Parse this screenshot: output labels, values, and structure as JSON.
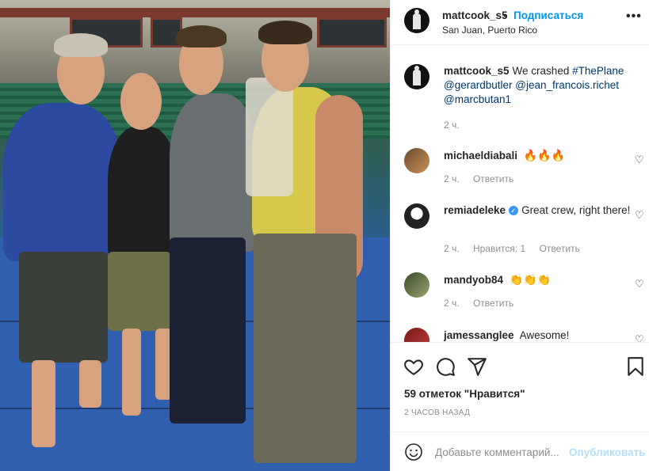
{
  "post": {
    "author": "mattcook_s5",
    "follow_label": "Подписаться",
    "dot": "•",
    "location": "San Juan, Puerto Rico",
    "more_icon": "more-dots-icon"
  },
  "caption": {
    "username": "mattcook_s5",
    "text": "We crashed",
    "hashtag": "#ThePlane",
    "mention1": "@gerardbutler",
    "mention2": "@jean_francois.richet",
    "mention3": "@marcbutan1",
    "time": "2 ч."
  },
  "comments": [
    {
      "username": "michaeldiabali",
      "text": "🔥🔥🔥",
      "time": "2 ч.",
      "likes": "",
      "reply": "Ответить"
    },
    {
      "username": "remiadeleke",
      "text": "Great crew, right there!",
      "time": "2 ч.",
      "likes": "Нравится: 1",
      "reply": "Ответить"
    },
    {
      "username": "mandyob84",
      "text": "👏👏👏",
      "time": "2 ч.",
      "likes": "",
      "reply": "Ответить"
    },
    {
      "username": "jamessanglee",
      "text": "Awesome!",
      "time": "",
      "likes": "",
      "reply": ""
    }
  ],
  "actions": {
    "likes_text": "59 отметок \"Нравится\"",
    "posted_ago": "2 часов назад"
  },
  "composer": {
    "placeholder": "Добавьте комментарий...",
    "publish_label": "Опубликовать"
  },
  "colors": {
    "link": "#00376b",
    "follow": "#0095f6",
    "publish_disabled": "#b2dffc",
    "muted": "#8e8e8e"
  }
}
